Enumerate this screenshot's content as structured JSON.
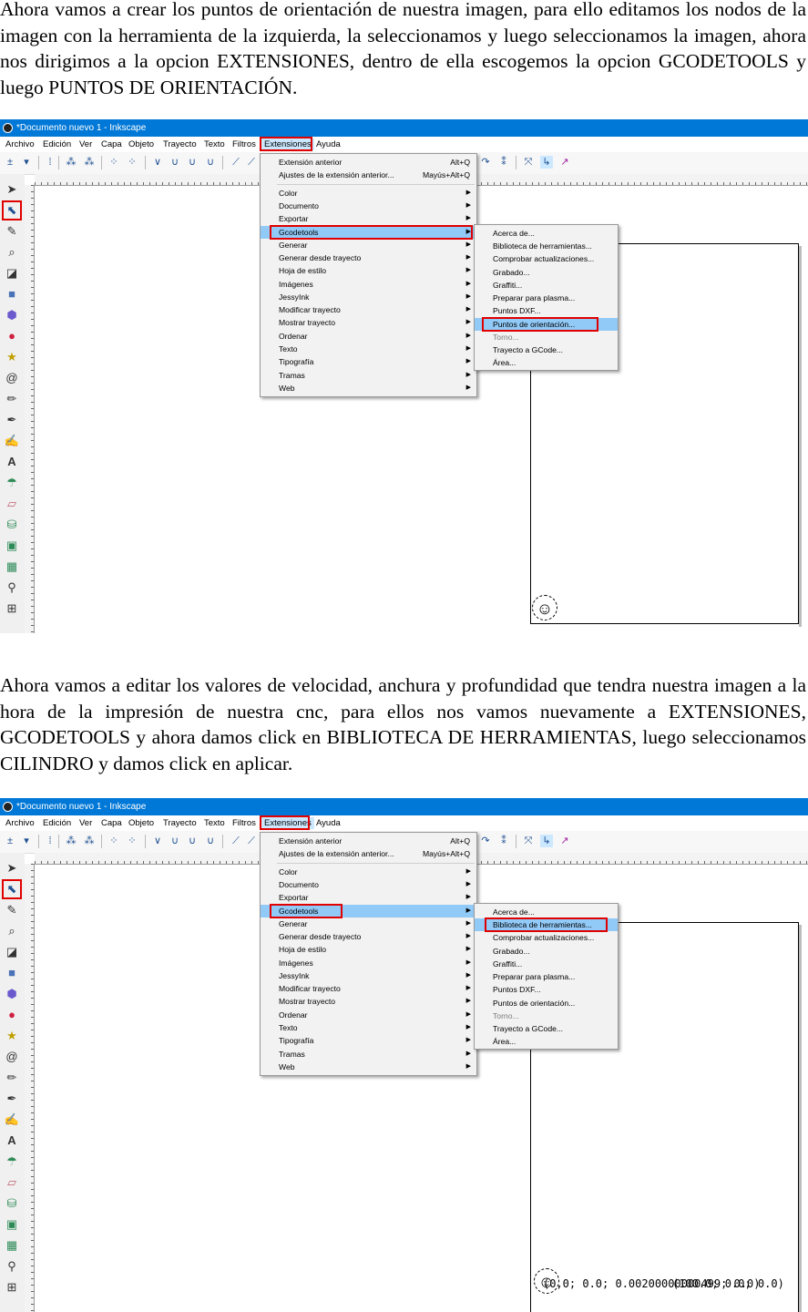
{
  "paragraphs": {
    "p1": "Ahora vamos a crear los puntos de orientación de nuestra imagen, para ello editamos los nodos de la imagen con la herramienta de la izquierda, la seleccionamos y luego seleccionamos la imagen, ahora nos dirigimos a la opcion EXTENSIONES, dentro de ella escogemos la opcion GCODETOOLS y luego PUNTOS DE ORIENTACIÓN.",
    "p2": "Ahora vamos a editar los valores de velocidad, anchura y profundidad que tendra nuestra imagen a la hora de la impresión de nuestra cnc, para ellos nos vamos nuevamente a EXTENSIONES, GCODETOOLS y ahora damos click en BIBLIOTECA DE HERRAMIENTAS,  luego seleccionamos CILINDRO y damos click en aplicar."
  },
  "window": {
    "title": "*Documento nuevo 1 - Inkscape"
  },
  "menubar": [
    "Archivo",
    "Edición",
    "Ver",
    "Capa",
    "Objeto",
    "Trayecto",
    "Texto",
    "Filtros",
    "Extensiones",
    "Ayuda"
  ],
  "extensions_menu": {
    "repeat_label": "Extensión anterior",
    "repeat_shortcut": "Alt+Q",
    "settings_label": "Ajustes de la extensión anterior...",
    "settings_shortcut": "Mayús+Alt+Q",
    "items": [
      "Color",
      "Documento",
      "Exportar",
      "Gcodetools",
      "Generar",
      "Generar desde trayecto",
      "Hoja de estilo",
      "Imágenes",
      "JessyInk",
      "Modificar trayecto",
      "Mostrar trayecto",
      "Ordenar",
      "Texto",
      "Tipografía",
      "Tramas",
      "Web"
    ]
  },
  "gcodetools_submenu": {
    "items": [
      "Acerca de...",
      "Biblioteca de herramientas...",
      "Comprobar actualizaciones...",
      "Grabado...",
      "Graffiti...",
      "Preparar para plasma...",
      "Puntos DXF...",
      "Puntos de orientación...",
      "Torno...",
      "Trayecto a GCode...",
      "Área..."
    ]
  },
  "canvas": {
    "coords_text": "(0,0; 0.0; 0.00200000000499; 0.0)",
    "coords_overlap": "(100.0; 0.0; 0.0)",
    "stray_mark": "´"
  },
  "colors": {
    "titlebar": "#0078d7",
    "highlight_box": "#e00000",
    "menu_selection": "#91c9f7"
  }
}
